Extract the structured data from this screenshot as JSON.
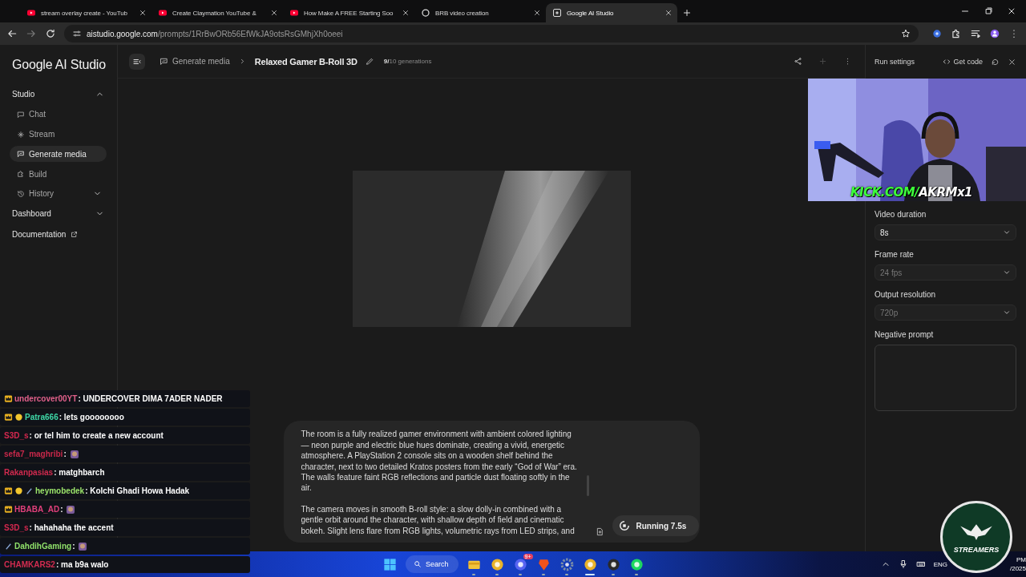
{
  "browser": {
    "tabs": [
      {
        "title": "stream overlay create - YouTub",
        "kind": "youtube",
        "selected": false
      },
      {
        "title": "Create Claymation YouTube &",
        "kind": "youtube",
        "selected": false
      },
      {
        "title": "How Make A FREE Starting Soo",
        "kind": "youtube",
        "selected": false
      },
      {
        "title": "BRB video creation",
        "kind": "ring",
        "selected": false
      },
      {
        "title": "Google AI Studio",
        "kind": "studio",
        "selected": true
      }
    ],
    "address": {
      "domain": "aistudio.google.com",
      "path": "/prompts/1RrBwORb56EfWkJA9otsRsGMhjXh0oeei"
    }
  },
  "sidebar": {
    "brand": "Google AI Studio",
    "nav": [
      {
        "label": "Studio",
        "kind": "section",
        "expanded": true,
        "children": [
          {
            "label": "Chat",
            "selected": false
          },
          {
            "label": "Stream",
            "selected": false
          },
          {
            "label": "Generate media",
            "selected": true
          },
          {
            "label": "Build",
            "selected": false
          },
          {
            "label": "History",
            "selected": false,
            "expanded": false
          }
        ]
      },
      {
        "label": "Dashboard",
        "kind": "section",
        "expanded": false
      },
      {
        "label": "Documentation",
        "kind": "link"
      }
    ]
  },
  "header": {
    "breadcrumb": "Generate media",
    "title": "Relaxed Gamer B-Roll 3D",
    "generations": "**9/**10 generations",
    "add_disabled": true
  },
  "prompt": {
    "paragraphs": [
      "The room is a fully realized gamer environment with ambient colored lighting — neon purple and electric blue hues dominate, creating a vivid, energetic atmosphere. A PlayStation 2 console sits on a wooden shelf behind the character, next to two detailed Kratos posters from the early “God of War” era. The walls feature faint RGB reflections and particle dust floating softly in the air.",
      "The camera moves in smooth B-roll style: a slow dolly-in combined with a gentle orbit around the character, with shallow depth of field and cinematic bokeh. Slight lens flare from RGB lights, volumetric rays from LED strips, and"
    ],
    "run_button": "Running 7.5s"
  },
  "run_settings": {
    "title": "Run settings",
    "get_code": "Get code",
    "fields": [
      {
        "label": "Video duration",
        "kind": "select",
        "value": "8s",
        "disabled": false
      },
      {
        "label": "Frame rate",
        "kind": "select",
        "value": "24 fps",
        "disabled": true
      },
      {
        "label": "Output resolution",
        "kind": "select",
        "value": "720p",
        "disabled": true
      },
      {
        "label": "Negative prompt",
        "kind": "textarea"
      }
    ]
  },
  "webcam": {
    "caption_prefix": "KICK.COM/",
    "caption_handle": "AKRMx1"
  },
  "chat": {
    "messages": [
      {
        "user": "undercover00YT",
        "color": "#e0608a",
        "text": ": UNDERCOVER DIMA 7ADER NADER",
        "kind": "text",
        "crown": true,
        "coin": false,
        "sword": false
      },
      {
        "user": "Patra666",
        "color": "#3ed6a6",
        "text": ": lets goooooooo",
        "kind": "text",
        "crown": true,
        "coin": true,
        "sword": false
      },
      {
        "user": "S3D_s",
        "color": "#d6284f",
        "text": ": or tel him to create a new account",
        "kind": "text",
        "crown": false,
        "coin": false,
        "sword": false
      },
      {
        "user": "sefa7_maghribi",
        "color": "#c8284a",
        "text": ":",
        "kind": "emote",
        "crown": false,
        "coin": false,
        "sword": false
      },
      {
        "user": "Rakanpasias",
        "color": "#d02a4e",
        "text": ": matghbarch",
        "kind": "text",
        "crown": false,
        "coin": false,
        "sword": false
      },
      {
        "user": "heymobedek",
        "color": "#9be36a",
        "text": ": Kolchi Ghadi Howa Hadak",
        "kind": "text",
        "crown": true,
        "coin": true,
        "sword": true
      },
      {
        "user": "HBABA_AD",
        "color": "#e0407a",
        "text": ":",
        "kind": "emote",
        "crown": true,
        "coin": false,
        "sword": false
      },
      {
        "user": "S3D_s",
        "color": "#d6284f",
        "text": ": hahahaha the accent",
        "kind": "text",
        "crown": false,
        "coin": false,
        "sword": false
      },
      {
        "user": "DahdihGaming",
        "color": "#8fe06a",
        "text": ":",
        "kind": "emote",
        "crown": false,
        "coin": false,
        "sword": true
      },
      {
        "user": "CHAMKARS2",
        "color": "#d22c50",
        "text": ": ma b9a walo",
        "kind": "text",
        "crown": false,
        "coin": false,
        "sword": false
      }
    ]
  },
  "taskbar": {
    "search": "Search",
    "apps": [
      {
        "kind": "explorer",
        "selected": false
      },
      {
        "kind": "chrome",
        "selected": false
      },
      {
        "kind": "discord",
        "selected": false,
        "badge": "9+"
      },
      {
        "kind": "brave",
        "selected": false
      },
      {
        "kind": "settings",
        "selected": false
      },
      {
        "kind": "chrome",
        "selected": true
      },
      {
        "kind": "obs",
        "selected": false
      },
      {
        "kind": "spotify",
        "selected": false
      }
    ],
    "language": "ENG",
    "clock": [
      "PM",
      "/2025"
    ]
  },
  "logo": {
    "text": "STREAMERS"
  }
}
